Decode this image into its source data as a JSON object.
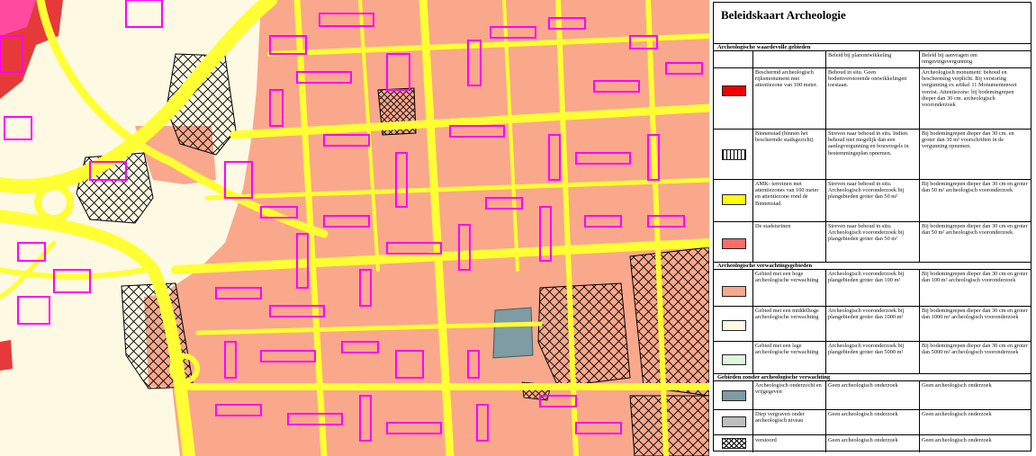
{
  "legend": {
    "title": "Beleidskaart Archeologie",
    "sections": [
      "Archeologische waardevolle gebieden",
      "Archeologische verwachtingsgebieden",
      "Gebieden zonder archeologische verwachting"
    ],
    "headers": [
      "Beleid bij planontwikkeling",
      "Beleid bij aanvragen om omgevingsvergunning"
    ],
    "rows": [
      {
        "name": "Beschermd archeologisch rijksmonument met attentiezone van 100 meter.",
        "plan": "Behoud in situ. Geen bodemverstorende ontwikkelingen toestaan.",
        "vergunning": "Archeologisch monument: behoud en bescherming verplicht. Bij verstoring vergunning ex artikel 11 Monumentenwet vereist. Attentiezone: bij bodemingrepen dieper dan 30 cm. archeologisch vooronderzoek",
        "swatch": "red",
        "color": "#ee0000"
      },
      {
        "name": "Binnenstad (binnen het beschermde stadsgezicht)",
        "plan": "Streven naar behoud in situ. Indien behoud niet mogelijk dan een aanlegvergunning en bouwregels in bestemmingsplan opnemen.",
        "vergunning": "Bij bodemingrepen dieper dan 30 cm. en groter dan 30 m² voorschriften in de vergunning opnemen.",
        "swatch": "vertical-hatch",
        "color": "#ffffff"
      },
      {
        "name": "AMK- terreinen met attentiezones van 100 meter en attentiezone rond de Binnenstad.",
        "plan": "Streven naar behoud in situ. Archeologisch vooronderzoek bij plangebieden groter dan 50 m²",
        "vergunning": "Bij bodemingrepen dieper dan 30 cm en groter dan 50 m² archeologisch vooronderzoek",
        "swatch": "yellow",
        "color": "#ffff00"
      },
      {
        "name": "De stadsturinen",
        "plan": "Streven naar behoud in situ. Archeologisch vooronderzoek bij plangebieden groter dan 50 m²",
        "vergunning": "Bij bodemingrepen dieper dan 30 cm en groter dan 50 m² archeologisch vooronderzoek",
        "swatch": "pink-red",
        "color": "#ff6b6b"
      },
      {
        "name": "Gebied met een hoge archeologische verwachting",
        "plan": "Archeologisch vooronderzoek bij plangebieden groter dan 100 m²",
        "vergunning": "Bij bodemingrepen dieper dan 30 cm en groter dan 100 m² archeologisch vooronderzoek",
        "swatch": "salmon",
        "color": "#f9a88c"
      },
      {
        "name": "Gebied met een middelhoge archeologische verwachting",
        "plan": "Archeologisch vooronderzoek bij plangebieden groter dan 1000 m²",
        "vergunning": "Bij bodemingrepen dieper dan 30 cm en groter dan 1000 m² archeologisch vooronderzoek",
        "swatch": "cream",
        "color": "#fdf9e3"
      },
      {
        "name": "Gebied met een lage archeologische verwachting",
        "plan": "Archeologisch vooronderzoek bij plangebieden groter dan 5000 m²",
        "vergunning": "Bij bodemingrepen dieper dan 30 cm en groter dan 5000 m² archeologisch vooronderzoek",
        "swatch": "light-green",
        "color": "#ddf7dd"
      },
      {
        "name": "Archeologisch onderzocht en vrijgegeven",
        "plan": "Geen archeologisch onderzoek",
        "vergunning": "Geen archeologisch onderzoek",
        "swatch": "slate",
        "color": "#7f9ba4"
      },
      {
        "name": "Diep vergraven onder archeologisch niveau",
        "plan": "Geen archeologisch onderzoek",
        "vergunning": "Geen archeologisch onderzoek",
        "swatch": "gray",
        "color": "#bdbdbd"
      },
      {
        "name": "verstoord",
        "plan": "Geen archeologisch onderzoek",
        "vergunning": "Geen archeologisch onderzoek",
        "swatch": "crosshatch",
        "color": "#ffffff"
      }
    ]
  },
  "map": {
    "colors": {
      "high_expectation": "#f9a88c",
      "roads": "#ffff33",
      "buildings": "#ff00ff",
      "medium_expectation": "#fdf9e3",
      "investigated": "#7f9ba4",
      "city_center": "#ee4444"
    }
  }
}
